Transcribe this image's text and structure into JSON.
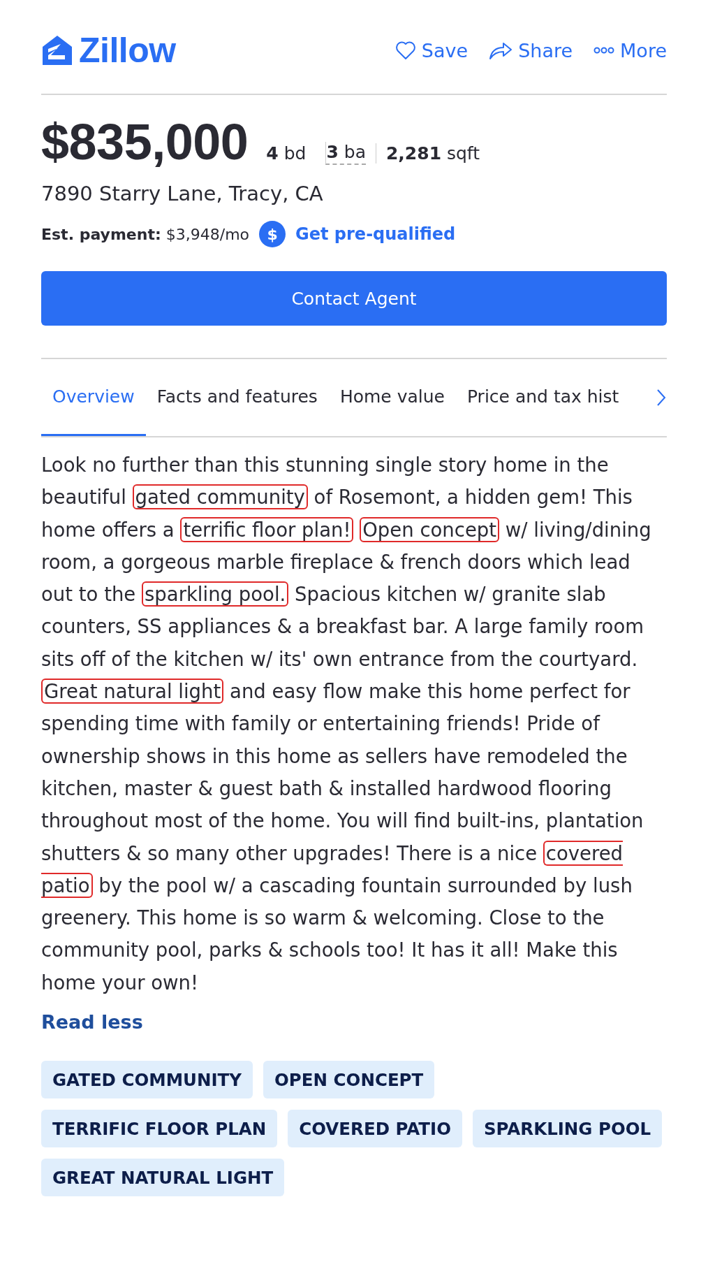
{
  "header": {
    "logo": "Zillow",
    "actions": [
      {
        "kind": "save",
        "label": "Save"
      },
      {
        "kind": "share",
        "label": "Share"
      },
      {
        "kind": "more",
        "label": "More"
      }
    ]
  },
  "listing": {
    "price": "$835,000",
    "facts": [
      {
        "value": "4",
        "unit": "bd",
        "dashed_underline": false
      },
      {
        "value": "3",
        "unit": "ba",
        "dashed_underline": true
      },
      {
        "value": "2,281",
        "unit": "sqft",
        "dashed_underline": false
      }
    ],
    "address": "7890 Starry Lane, Tracy, CA",
    "payment": {
      "label": "Est. payment:",
      "value": "$3,948/mo",
      "icon_glyph": "$",
      "link": "Get pre-qualified"
    }
  },
  "contact_button": "Contact Agent",
  "tabs": [
    {
      "label": "Overview",
      "selected": true
    },
    {
      "label": "Facts and features",
      "selected": false
    },
    {
      "label": "Home value",
      "selected": false
    },
    {
      "label": "Price and tax hist",
      "selected": false
    }
  ],
  "description": {
    "segments": [
      {
        "text": "Look no further than this stunning single story home in the beautiful ",
        "highlighted": false
      },
      {
        "text": "gated community",
        "highlighted": true
      },
      {
        "text": " of  Rosemont, a  hidden gem! This home offers a ",
        "highlighted": false
      },
      {
        "text": "terrific floor plan!",
        "highlighted": true
      },
      {
        "text": "Open concept",
        "highlighted": true
      },
      {
        "text": " w/ living/dining room, a gorgeous marble fireplace & french doors which lead out to the ",
        "highlighted": false
      },
      {
        "text": "sparkling pool.",
        "highlighted": true
      },
      {
        "text": " Spacious kitchen w/ granite slab counters, SS appliances & a breakfast bar. A large family room sits off of the kitchen w/ its' own entrance from the courtyard. ",
        "highlighted": false
      },
      {
        "text": "Great natural light",
        "highlighted": true
      },
      {
        "text": " and easy flow make this home perfect for spending time with family or entertaining friends!  Pride of ownership shows in this home as sellers have remodeled the kitchen, master & guest bath & installed hardwood flooring throughout most of the home. You will find built-ins, plantation shutters & so many other upgrades! There is a nice ",
        "highlighted": false
      },
      {
        "text": "covered patio",
        "highlighted": true
      },
      {
        "text": " by the pool w/ a cascading fountain surrounded by lush greenery. This home is so warm & welcoming. Close to the community pool, parks & schools too! It has it all!  Make this home your own!",
        "highlighted": false
      }
    ],
    "toggle": "Read less"
  },
  "tags": [
    "GATED COMMUNITY",
    "OPEN CONCEPT",
    "TERRIFIC FLOOR PLAN",
    "COVERED PATIO",
    "SPARKLING POOL",
    "GREAT NATURAL LIGHT"
  ]
}
